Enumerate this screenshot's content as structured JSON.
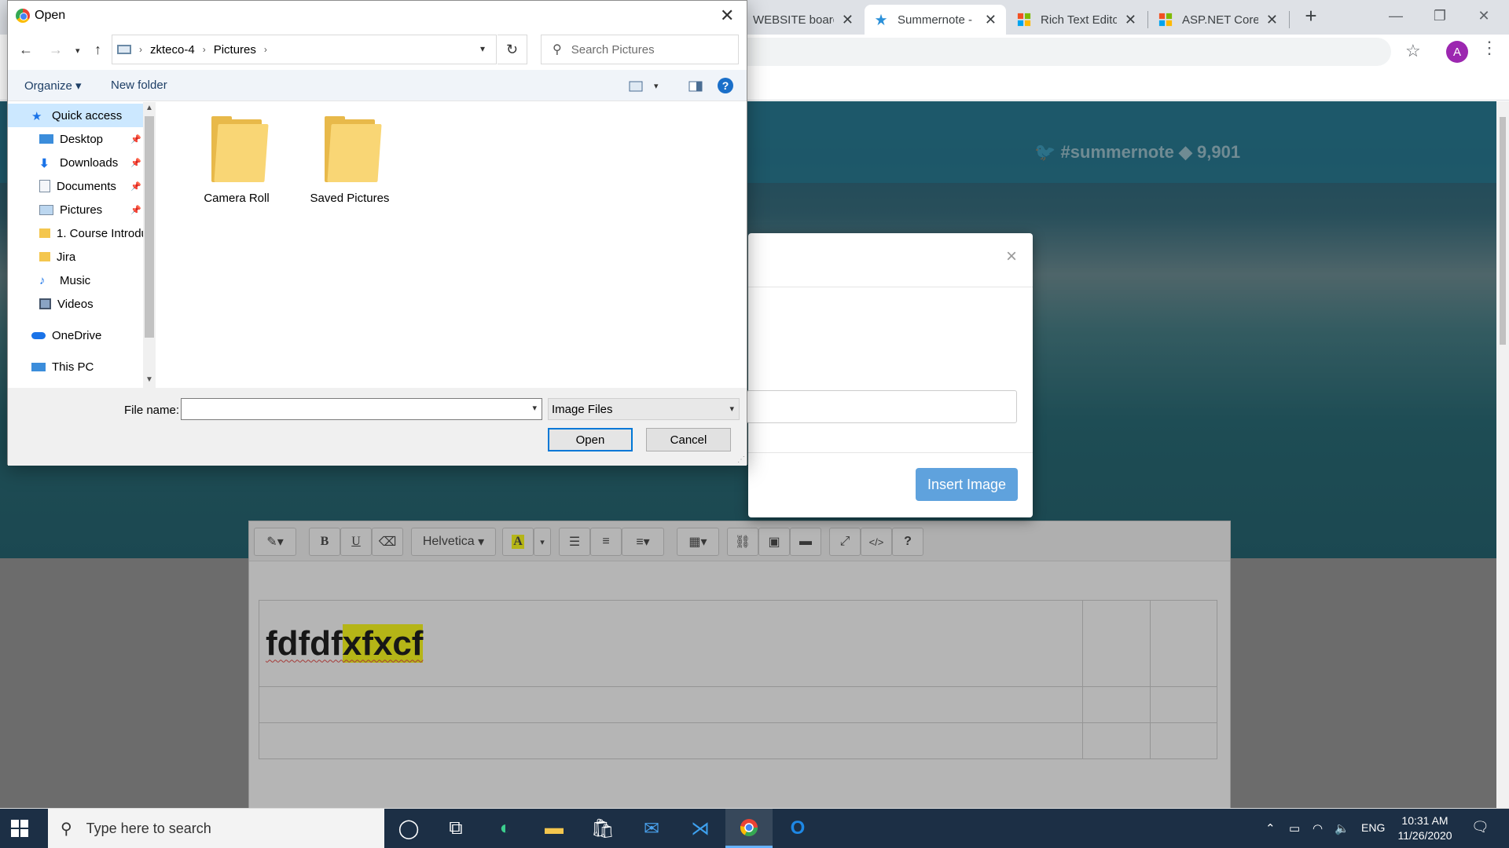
{
  "browser": {
    "tabs": [
      {
        "title": "WEBSITE board",
        "favicon": "trello-icon"
      },
      {
        "title": "Summernote -",
        "favicon": "summernote-icon"
      },
      {
        "title": "Rich Text Editor",
        "favicon": "windows-icon"
      },
      {
        "title": "ASP.NET Core I",
        "favicon": "windows-icon"
      }
    ],
    "active_tab": 1,
    "profile_initial": "A"
  },
  "page": {
    "social_twitter": "#summernote",
    "social_github": "9,901",
    "modal": {
      "insert_button": "Insert Image"
    },
    "editor": {
      "font_dropdown": "Helvetica",
      "content_plain": "fdfdf",
      "content_highlighted": "xfxcf",
      "highlight_color": "#ffff00"
    }
  },
  "dialog": {
    "title": "Open",
    "breadcrumb": [
      "zkteco-4",
      "Pictures"
    ],
    "search_placeholder": "Search Pictures",
    "commands": {
      "organize": "Organize",
      "new_folder": "New folder"
    },
    "nav_items": [
      {
        "label": "Quick access",
        "icon": "star-icon",
        "selected": true
      },
      {
        "label": "Desktop",
        "icon": "desktop-icon",
        "pinned": true
      },
      {
        "label": "Downloads",
        "icon": "download-icon",
        "pinned": true
      },
      {
        "label": "Documents",
        "icon": "documents-icon",
        "pinned": true
      },
      {
        "label": "Pictures",
        "icon": "pictures-icon",
        "pinned": true
      },
      {
        "label": "1. Course Introdu",
        "icon": "folder-icon"
      },
      {
        "label": "Jira",
        "icon": "folder-icon"
      },
      {
        "label": "Music",
        "icon": "music-icon"
      },
      {
        "label": "Videos",
        "icon": "videos-icon"
      },
      {
        "label": "OneDrive",
        "icon": "cloud-icon"
      },
      {
        "label": "This PC",
        "icon": "pc-icon"
      }
    ],
    "folders": [
      {
        "label": "Camera Roll"
      },
      {
        "label": "Saved Pictures"
      }
    ],
    "file_name_label": "File name:",
    "file_name_value": "",
    "file_type": "Image Files",
    "open_button": "Open",
    "cancel_button": "Cancel"
  },
  "taskbar": {
    "search_placeholder": "Type here to search",
    "apps": [
      "cortana-icon",
      "task-view-icon",
      "edge-icon",
      "file-explorer-icon",
      "store-icon",
      "mail-icon",
      "vscode-icon",
      "chrome-icon",
      "outlook-icon"
    ],
    "language": "ENG",
    "time": "10:31 AM",
    "date": "11/26/2020"
  }
}
